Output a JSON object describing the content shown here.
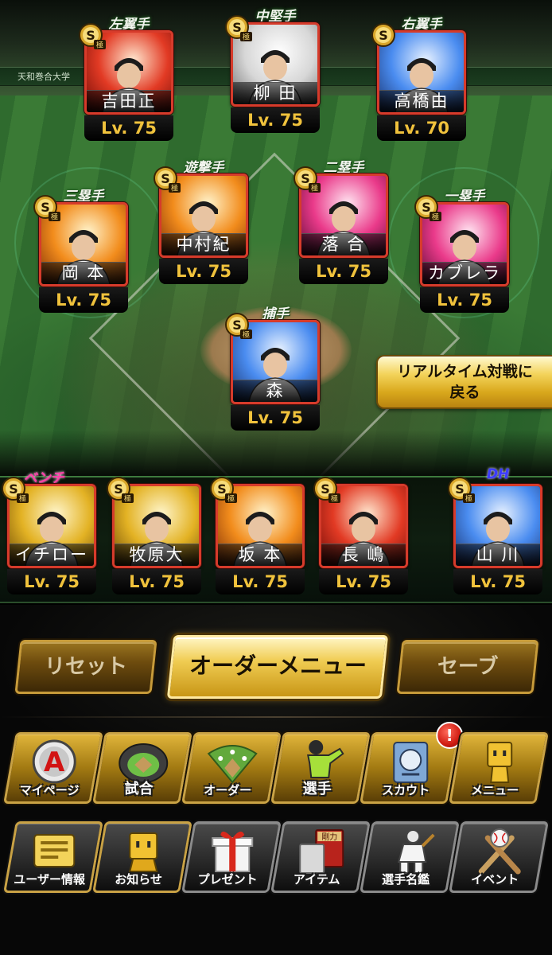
{
  "positions": {
    "left_field": "左翼手",
    "center_field": "中堅手",
    "right_field": "右翼手",
    "shortstop": "遊撃手",
    "second_base": "二塁手",
    "third_base": "三塁手",
    "first_base": "一塁手",
    "catcher": "捕手",
    "bench": "ベンチ",
    "dh": "DH"
  },
  "lineup": {
    "left_field": {
      "name": "吉田正",
      "level": "Lv. 75",
      "rank": "S極",
      "palette": "red"
    },
    "center_field": {
      "name": "柳 田",
      "level": "Lv. 75",
      "rank": "S極",
      "palette": "white"
    },
    "right_field": {
      "name": "高橋由",
      "level": "Lv. 70",
      "rank": "S",
      "palette": "blue"
    },
    "third_base": {
      "name": "岡 本",
      "level": "Lv. 75",
      "rank": "S極",
      "palette": "orange"
    },
    "shortstop": {
      "name": "中村紀",
      "level": "Lv. 75",
      "rank": "S極",
      "palette": "orange"
    },
    "second_base": {
      "name": "落 合",
      "level": "Lv. 75",
      "rank": "S極",
      "palette": "pink"
    },
    "first_base": {
      "name": "カブレラ",
      "level": "Lv. 75",
      "rank": "S極",
      "palette": "pink"
    },
    "catcher": {
      "name": "森",
      "level": "Lv. 75",
      "rank": "S極",
      "palette": "blue"
    }
  },
  "bench": [
    {
      "name": "イチロー",
      "level": "Lv. 75",
      "rank": "S極",
      "palette": "gold"
    },
    {
      "name": "牧原大",
      "level": "Lv. 75",
      "rank": "S極",
      "palette": "gold"
    },
    {
      "name": "坂 本",
      "level": "Lv. 75",
      "rank": "S極",
      "palette": "orange"
    },
    {
      "name": "長 嶋",
      "level": "Lv. 75",
      "rank": "S極",
      "palette": "red"
    }
  ],
  "designated_hitter": {
    "name": "山 川",
    "level": "Lv. 75",
    "rank": "S極",
    "palette": "blue"
  },
  "realtime_button": {
    "line1": "リアルタイム対戦に",
    "line2": "戻る"
  },
  "order_controls": {
    "reset": "リセット",
    "order_menu": "オーダーメニュー",
    "save": "セーブ"
  },
  "nav_row1": [
    {
      "label": "マイページ",
      "icon": "a-emblem-icon"
    },
    {
      "label": "試合",
      "icon": "stadium-icon"
    },
    {
      "label": "オーダー",
      "icon": "field-formation-icon"
    },
    {
      "label": "選手",
      "icon": "player-pitching-icon"
    },
    {
      "label": "スカウト",
      "icon": "scout-emblem-icon",
      "alert": "!"
    },
    {
      "label": "メニュー",
      "icon": "cube-mascot-icon"
    }
  ],
  "nav_row2": [
    {
      "label": "ユーザー情報",
      "icon": "user-card-icon"
    },
    {
      "label": "お知らせ",
      "icon": "notice-mascot-icon"
    },
    {
      "label": "プレゼント",
      "icon": "gift-box-icon"
    },
    {
      "label": "アイテム",
      "icon": "item-book-icon",
      "book_text": "剛力"
    },
    {
      "label": "選手名鑑",
      "icon": "player-catalog-icon"
    },
    {
      "label": "イベント",
      "icon": "bats-ball-icon"
    }
  ],
  "stadium_signs": [
    "天和巻合大学"
  ],
  "colors": {
    "accent_gold": "#f0c23c",
    "card_border": "#d63b2b",
    "field_green": "#2f6b2e",
    "bench_label": "#ff3fa8",
    "dh_label": "#3c3cff"
  }
}
